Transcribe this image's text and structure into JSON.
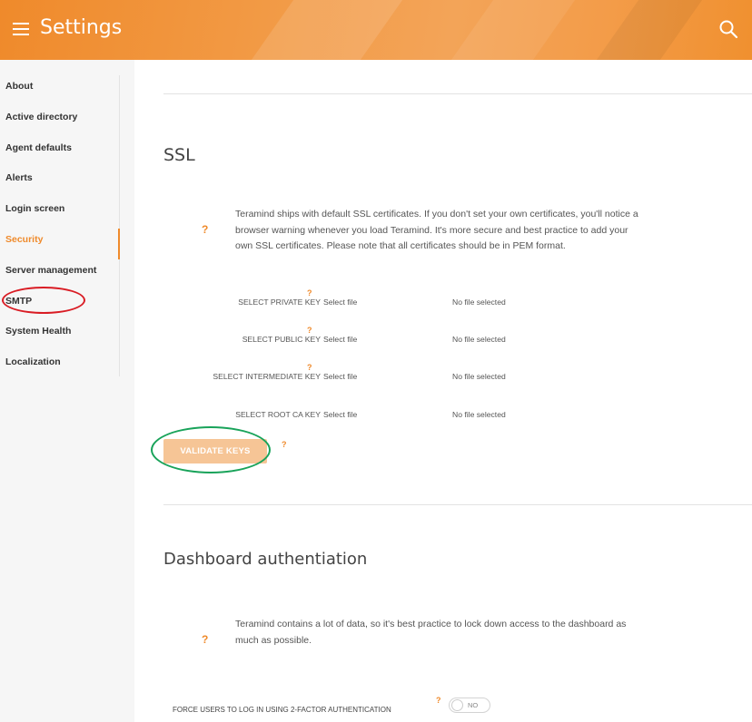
{
  "header": {
    "title": "Settings"
  },
  "sidebar": {
    "items": [
      {
        "label": "About"
      },
      {
        "label": "Active directory"
      },
      {
        "label": "Agent defaults"
      },
      {
        "label": "Alerts"
      },
      {
        "label": "Login screen"
      },
      {
        "label": "Security",
        "active": true
      },
      {
        "label": "Server management"
      },
      {
        "label": "SMTP"
      },
      {
        "label": "System Health"
      },
      {
        "label": "Localization"
      }
    ]
  },
  "ssl": {
    "title": "SSL",
    "help": "?",
    "info_lines": [
      "Teramind ships with default SSL certificates. If you don't set your own certificates, you'll notice a",
      "browser warning whenever you load Teramind. It's more secure and best practice to add your",
      "own SSL certificates. Please note that all certificates should be in PEM format."
    ],
    "keys": [
      {
        "label": "SELECT PRIVATE KEY",
        "has_help": true,
        "select": "Select file",
        "status": "No file selected"
      },
      {
        "label": "SELECT PUBLIC KEY",
        "has_help": true,
        "select": "Select file",
        "status": "No file selected"
      },
      {
        "label": "SELECT INTERMEDIATE KEY",
        "has_help": true,
        "select": "Select file",
        "status": "No file selected"
      },
      {
        "label": "SELECT ROOT CA KEY",
        "has_help": false,
        "select": "Select file",
        "status": "No file selected"
      }
    ],
    "validate_label": "VALIDATE KEYS"
  },
  "dashboard_auth": {
    "title": "Dashboard authentiation",
    "help": "?",
    "info_lines": [
      "Teramind contains a lot of data, so it's best practice to lock down access to the dashboard as",
      "much as possible."
    ],
    "force_2fa_label": "FORCE USERS TO LOG IN USING 2-FACTOR AUTHENTICATION",
    "toggle_label": "NO"
  },
  "colors": {
    "accent": "#ef8a2b",
    "annotation_red": "#d91c24",
    "annotation_green": "#19a35a"
  },
  "icons": {
    "menu": "hamburger-icon",
    "search": "search-icon",
    "help": "question-mark"
  }
}
